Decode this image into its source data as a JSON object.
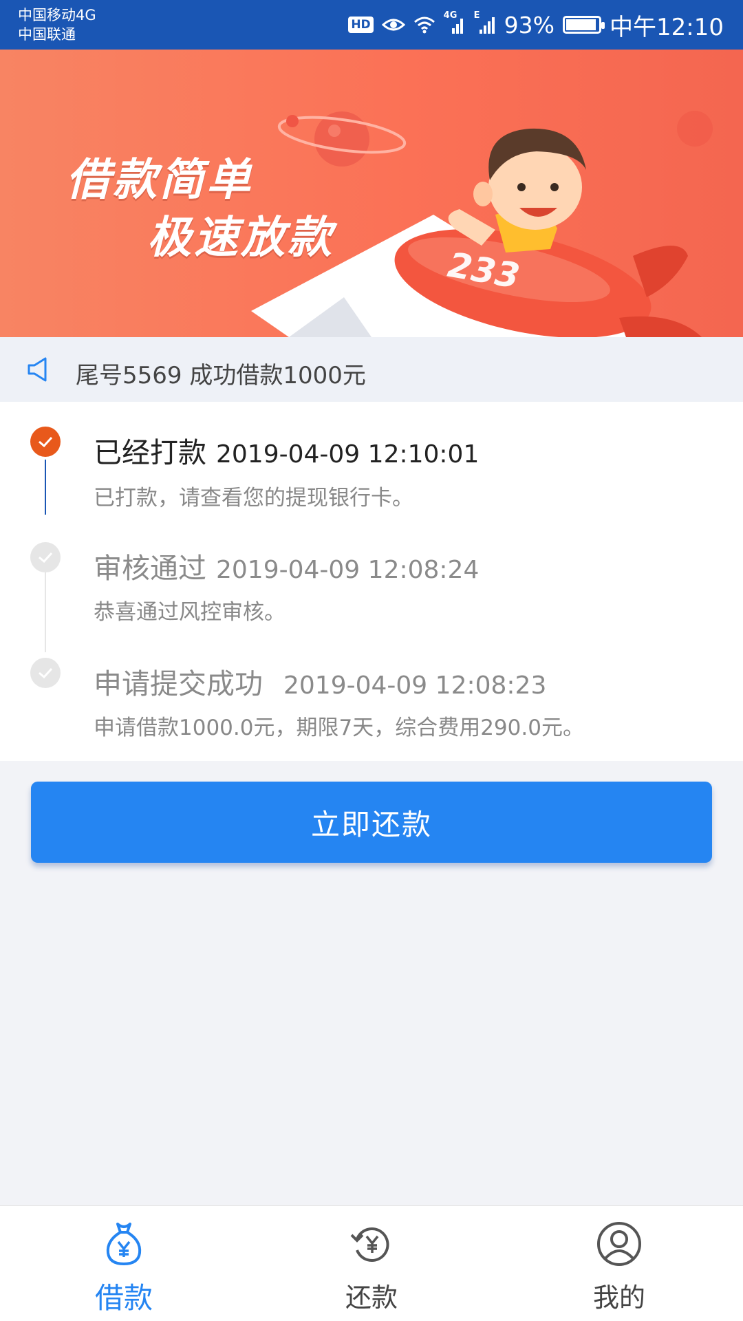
{
  "status_bar": {
    "carrier1": "中国移动4G",
    "carrier2": "中国联通",
    "hd_badge": "HD",
    "net_4g": "4G",
    "net_e": "E",
    "battery": "93%",
    "time": "中午12:10",
    "battery_level": 0.93
  },
  "banner": {
    "line1": "借款简单",
    "line2": "极速放款",
    "plane_number": "233"
  },
  "notice": {
    "text": "尾号5569 成功借款1000元"
  },
  "timeline": [
    {
      "title": "已经打款",
      "time": "2019-04-09 12:10:01",
      "desc": "已打款，请查看您的提现银行卡。",
      "state": "active"
    },
    {
      "title": "审核通过",
      "time": "2019-04-09 12:08:24",
      "desc": "恭喜通过风控审核。",
      "state": "done"
    },
    {
      "title": "申请提交成功",
      "time": "2019-04-09 12:08:23",
      "desc": "申请借款1000.0元，期限7天，综合费用290.0元。",
      "state": "done"
    }
  ],
  "repay_button": "立即还款",
  "nav": [
    {
      "label": "借款",
      "icon": "money-bag-icon",
      "active": true
    },
    {
      "label": "还款",
      "icon": "repay-cycle-icon",
      "active": false
    },
    {
      "label": "我的",
      "icon": "user-profile-icon",
      "active": false
    }
  ],
  "colors": {
    "status_bar": "#1a56b4",
    "accent_blue": "#2585f2",
    "active_step": "#e8591b",
    "banner": "#fb7156"
  }
}
